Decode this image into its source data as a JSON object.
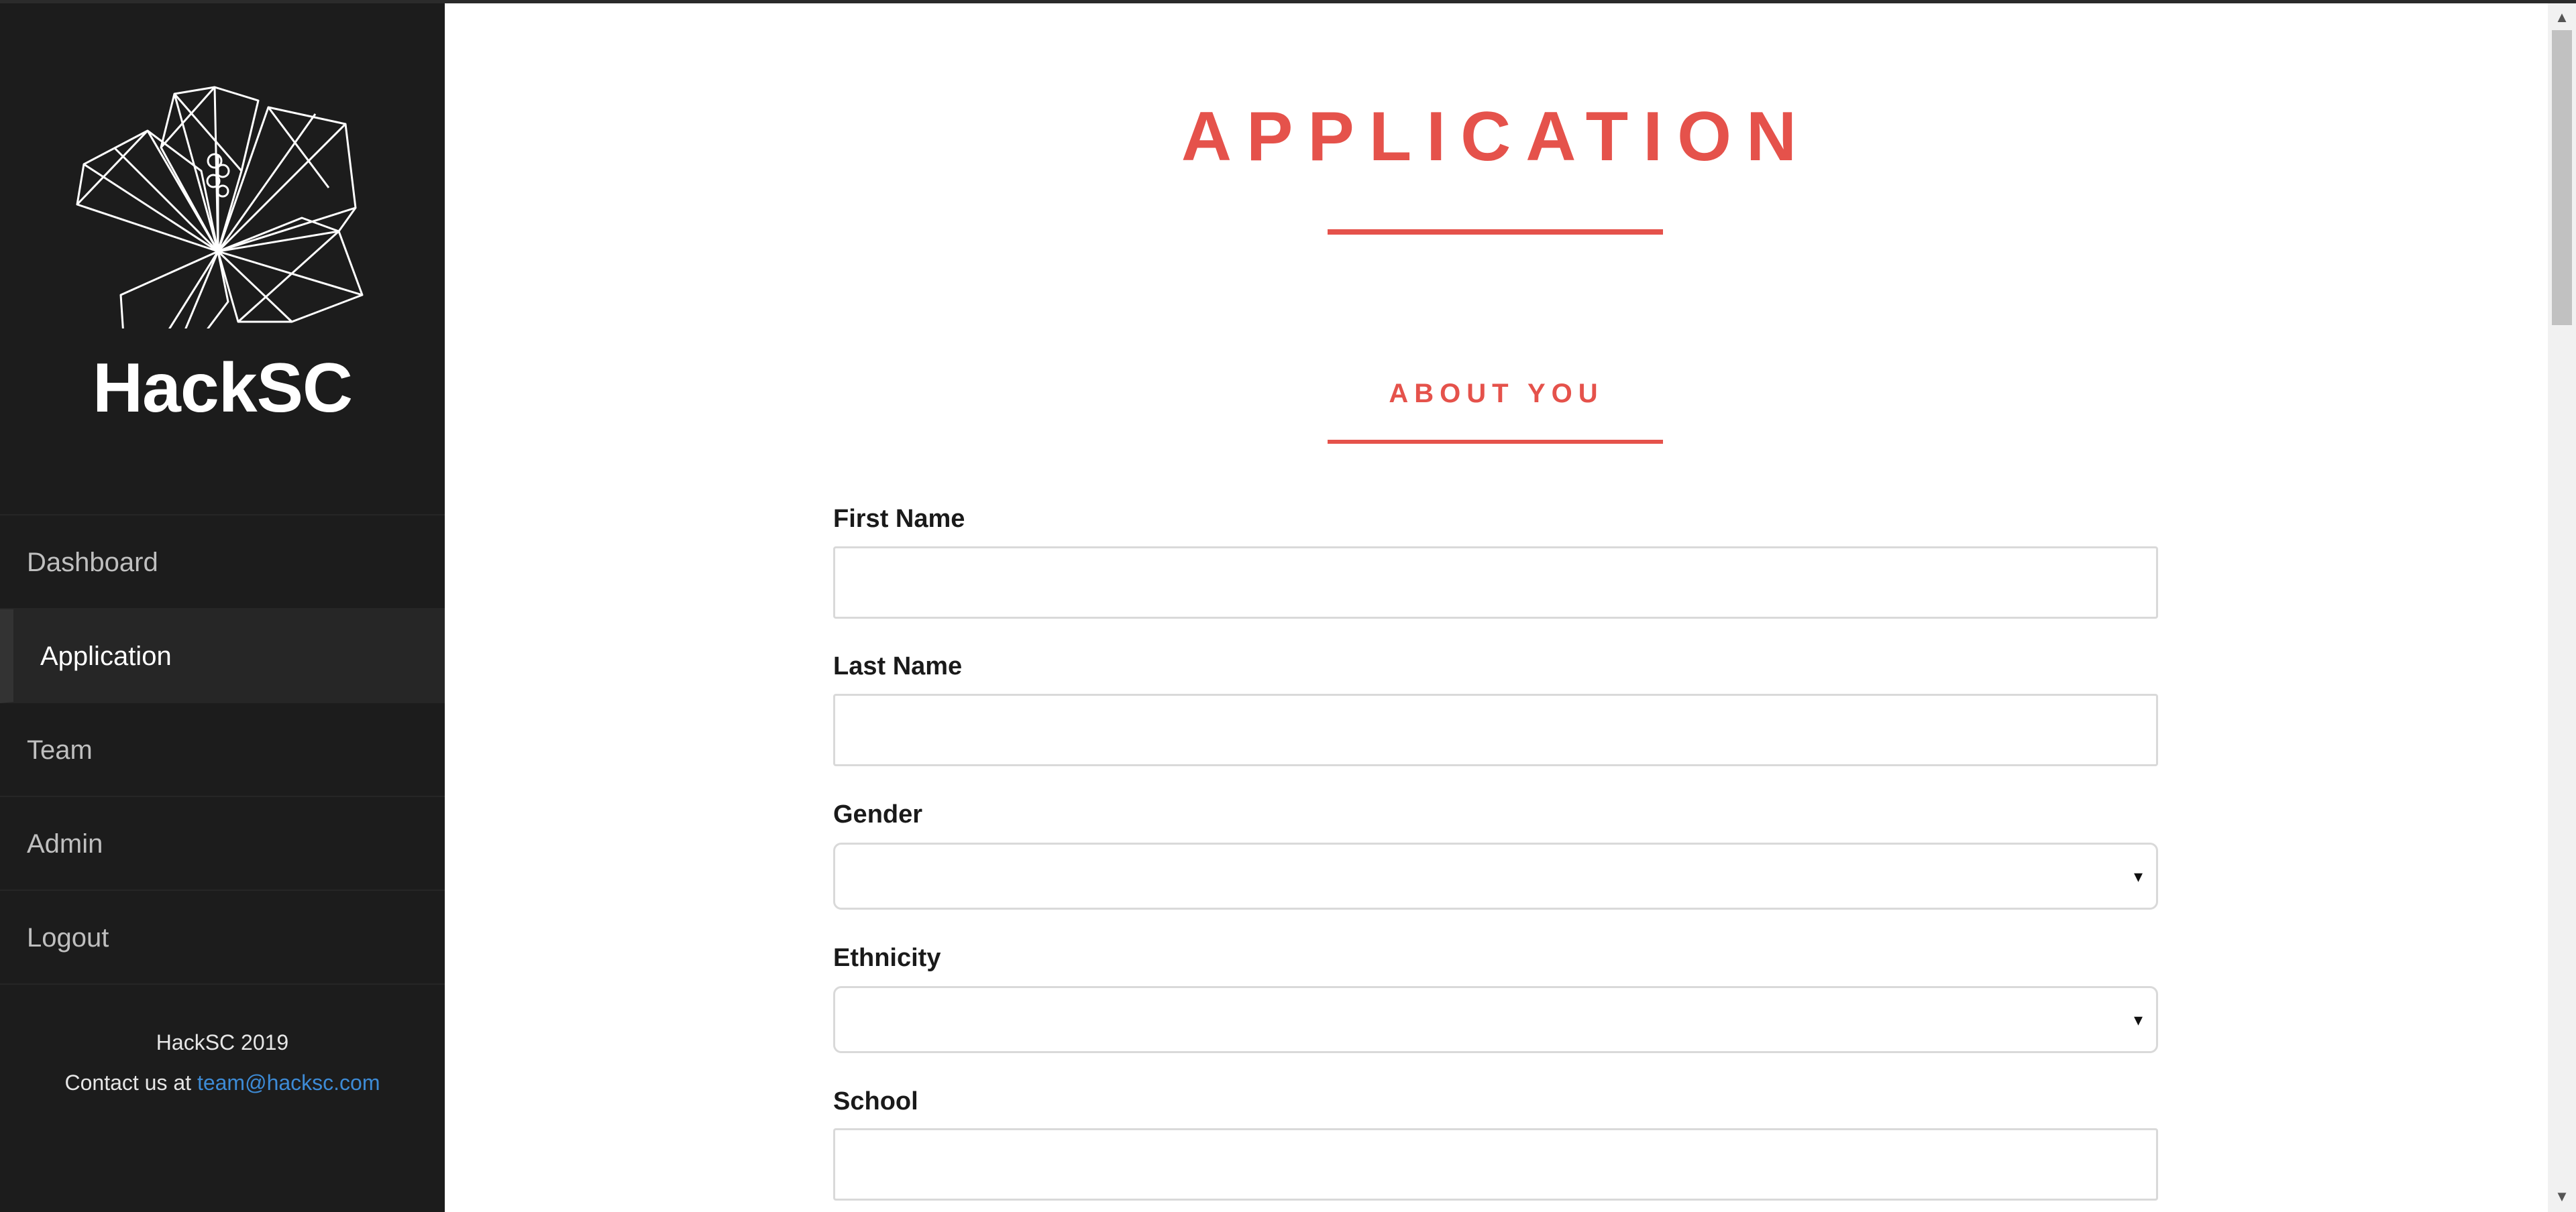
{
  "sidebar": {
    "brand": "HackSC",
    "logo": "hibiscus-line-art-logo",
    "nav": [
      {
        "label": "Dashboard",
        "active": false
      },
      {
        "label": "Application",
        "active": true
      },
      {
        "label": "Team",
        "active": false
      },
      {
        "label": "Admin",
        "active": false
      },
      {
        "label": "Logout",
        "active": false
      }
    ],
    "footer": {
      "line1": "HackSC 2019",
      "contact_prefix": "Contact us at ",
      "contact_email": "team@hacksc.com"
    }
  },
  "main": {
    "title": "APPLICATION",
    "section_title": "ABOUT YOU",
    "fields": {
      "first_name": {
        "label": "First Name",
        "value": ""
      },
      "last_name": {
        "label": "Last Name",
        "value": ""
      },
      "gender": {
        "label": "Gender",
        "value": ""
      },
      "ethnicity": {
        "label": "Ethnicity",
        "value": ""
      },
      "school": {
        "label": "School",
        "value": ""
      }
    }
  },
  "icons": {
    "select_caret": "▾",
    "scroll_up": "▲",
    "scroll_down": "▼"
  },
  "colors": {
    "accent": "#e5524b",
    "sidebar_bg": "#1c1c1c",
    "link": "#3d8bd6"
  }
}
